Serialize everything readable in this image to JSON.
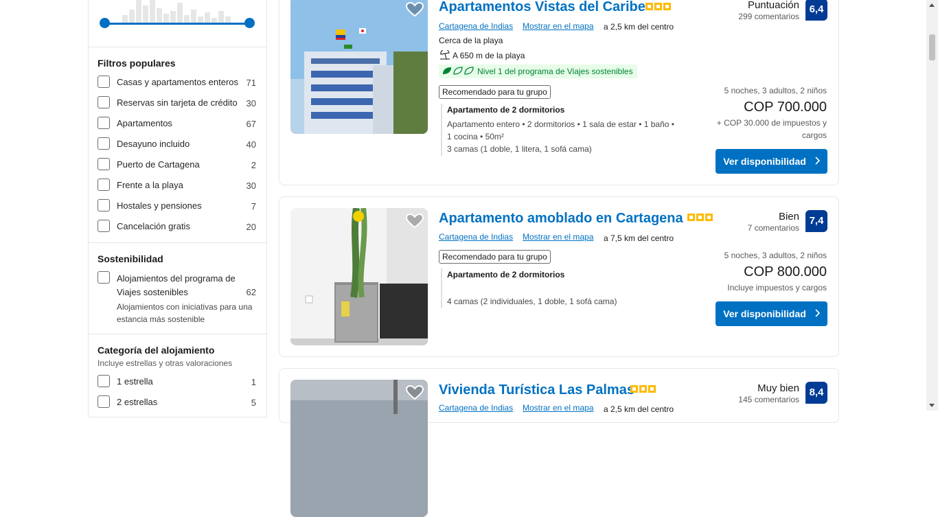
{
  "filters": {
    "popular": {
      "title": "Filtros populares",
      "items": [
        {
          "label": "Casas y apartamentos enteros",
          "count": "71"
        },
        {
          "label": "Reservas sin tarjeta de crédito",
          "count": "30"
        },
        {
          "label": "Apartamentos",
          "count": "67"
        },
        {
          "label": "Desayuno incluido",
          "count": "40"
        },
        {
          "label": "Puerto de Cartagena",
          "count": "2"
        },
        {
          "label": "Frente a la playa",
          "count": "30"
        },
        {
          "label": "Hostales y pensiones",
          "count": "7"
        },
        {
          "label": "Cancelación gratis",
          "count": "20"
        }
      ]
    },
    "sustainability": {
      "title": "Sostenibilidad",
      "item_label_1": "Alojamientos del programa de",
      "item_label_2": "Viajes sostenibles",
      "item_count": "62",
      "desc_1": "Alojamientos con iniciativas para una",
      "desc_2": "estancia más sostenible"
    },
    "category": {
      "title": "Categoría del alojamiento",
      "subtitle": "Incluye estrellas y otras valoraciones",
      "items": [
        {
          "label": "1 estrella",
          "count": "1"
        },
        {
          "label": "2 estrellas",
          "count": "5"
        }
      ]
    }
  },
  "properties": [
    {
      "name": "Apartamentos Vistas del Caribe",
      "stars": 3,
      "location": "Cartagena de Indias",
      "map_link": "Mostrar en el mapa",
      "distance": "a 2,5 km del centro",
      "near": "Cerca de la playa",
      "beach": "A 650 m de la playa",
      "sustainable": "Nivel 1 del programa de Viajes sostenibles",
      "recommended": "Recomendado para tu grupo",
      "room_title": "Apartamento de 2 dormitorios",
      "room_detail_1": "Apartamento entero • 2 dormitorios • 1 sala de estar • 1 baño •",
      "room_detail_2": "1 cocina • 50m²",
      "beds": "3 camas (1 doble, 1 litera, 1 sofá cama)",
      "score_label": "Puntuación",
      "reviews": "299 comentarios",
      "score": "6,4",
      "stay": "5 noches, 3 adultos, 2 niños",
      "price": "COP 700.000",
      "tax_1": "+ COP 30.000 de impuestos y",
      "tax_2": "cargos",
      "button": "Ver disponibilidad"
    },
    {
      "name": "Apartamento amoblado en Cartagena",
      "stars": 3,
      "location": "Cartagena de Indias",
      "map_link": "Mostrar en el mapa",
      "distance": "a 7,5 km del centro",
      "recommended": "Recomendado para tu grupo",
      "room_title": "Apartamento de 2 dormitorios",
      "beds": "4 camas (2 individuales, 1 doble, 1 sofá cama)",
      "score_label": "Bien",
      "reviews": "7 comentarios",
      "score": "7,4",
      "stay": "5 noches, 3 adultos, 2 niños",
      "price": "COP 800.000",
      "tax_1": "Incluye impuestos y cargos",
      "button": "Ver disponibilidad"
    },
    {
      "name": "Vivienda Turística Las Palmas",
      "stars": 3,
      "location": "Cartagena de Indias",
      "map_link": "Mostrar en el mapa",
      "distance": "a 2,5 km del centro",
      "score_label": "Muy bien",
      "reviews": "145 comentarios",
      "score": "8,4"
    }
  ],
  "colors": {
    "brand_blue": "#0071c2",
    "score_blue": "#003b95",
    "star_yellow": "#febb02",
    "sustainable_green": "#008234"
  }
}
